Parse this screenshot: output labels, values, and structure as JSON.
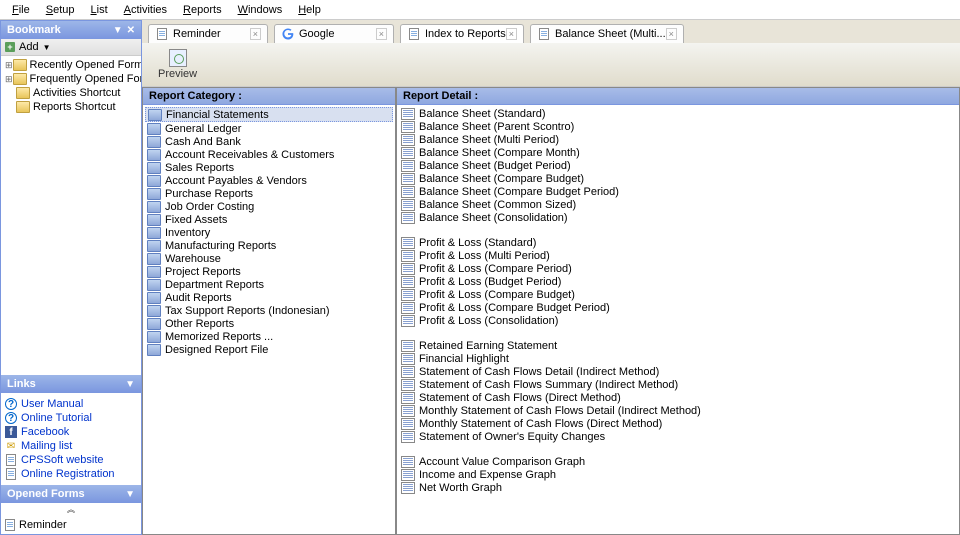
{
  "menu": [
    "File",
    "Setup",
    "List",
    "Activities",
    "Reports",
    "Windows",
    "Help"
  ],
  "sidebar": {
    "bookmark": {
      "title": "Bookmark",
      "add_label": "Add",
      "tree": [
        {
          "label": "Recently Opened Forms",
          "expandable": true
        },
        {
          "label": "Frequently Opened Forms",
          "expandable": true
        },
        {
          "label": "Activities Shortcut",
          "expandable": false
        },
        {
          "label": "Reports Shortcut",
          "expandable": false
        }
      ]
    },
    "links": {
      "title": "Links",
      "items": [
        {
          "label": "User Manual",
          "icon": "q"
        },
        {
          "label": "Online Tutorial",
          "icon": "q"
        },
        {
          "label": "Facebook",
          "icon": "fb"
        },
        {
          "label": "Mailing list",
          "icon": "mail"
        },
        {
          "label": "CPSSoft website",
          "icon": "doc"
        },
        {
          "label": "Online Registration",
          "icon": "doc"
        }
      ]
    },
    "opened": {
      "title": "Opened Forms",
      "items": [
        "Reminder"
      ]
    }
  },
  "tabs": [
    {
      "label": "Reminder",
      "icon": "doc"
    },
    {
      "label": "Google",
      "icon": "google"
    },
    {
      "label": "Index to Reports",
      "icon": "doc",
      "active": true
    },
    {
      "label": "Balance Sheet (Multi...",
      "icon": "doc"
    }
  ],
  "toolbar": {
    "preview": "Preview"
  },
  "category": {
    "header": "Report Category :",
    "items": [
      "Financial Statements",
      "General Ledger",
      "Cash And Bank",
      "Account Receivables & Customers",
      "Sales Reports",
      "Account Payables & Vendors",
      "Purchase Reports",
      "Job Order Costing",
      "Fixed Assets",
      "Inventory",
      "Manufacturing Reports",
      "Warehouse",
      "Project Reports",
      "Department Reports",
      "Audit Reports",
      "Tax Support Reports (Indonesian)",
      "Other Reports",
      "Memorized Reports ...",
      "Designed Report File"
    ],
    "selected_index": 0
  },
  "detail": {
    "header": "Report Detail :",
    "groups": [
      [
        "Balance Sheet (Standard)",
        "Balance Sheet (Parent Scontro)",
        "Balance Sheet (Multi Period)",
        "Balance Sheet (Compare Month)",
        "Balance Sheet (Budget Period)",
        "Balance Sheet (Compare Budget)",
        "Balance Sheet (Compare Budget Period)",
        "Balance Sheet (Common Sized)",
        "Balance Sheet (Consolidation)"
      ],
      [
        "Profit & Loss (Standard)",
        "Profit & Loss (Multi Period)",
        "Profit & Loss (Compare Period)",
        "Profit & Loss (Budget Period)",
        "Profit & Loss (Compare Budget)",
        "Profit & Loss (Compare Budget Period)",
        "Profit & Loss (Consolidation)"
      ],
      [
        "Retained Earning Statement",
        "Financial Highlight",
        "Statement of Cash Flows Detail (Indirect Method)",
        "Statement of Cash Flows Summary (Indirect Method)",
        "Statement of Cash Flows (Direct Method)",
        "Monthly Statement of Cash Flows Detail (Indirect Method)",
        "Monthly Statement of Cash Flows (Direct Method)",
        "Statement of Owner's Equity Changes"
      ],
      [
        "Account Value Comparison Graph",
        "Income and Expense Graph",
        "Net Worth Graph"
      ]
    ]
  }
}
